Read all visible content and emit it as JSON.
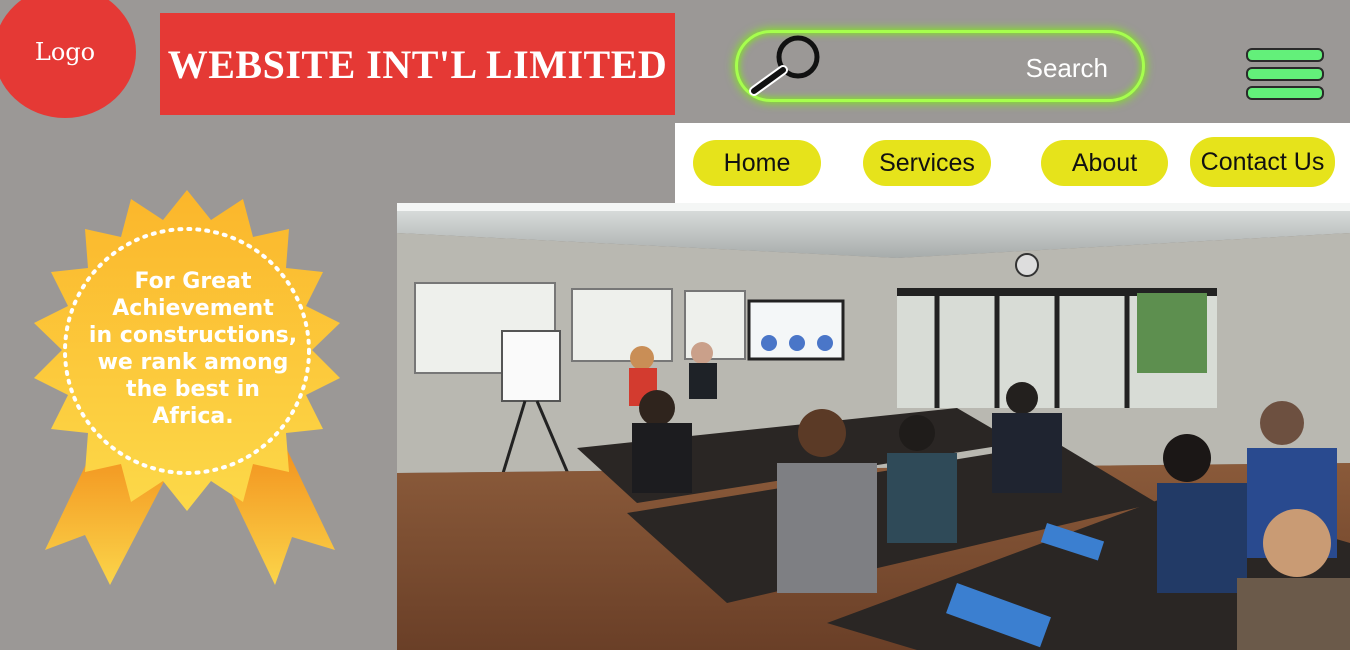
{
  "logo": {
    "label": "Logo"
  },
  "header": {
    "title": "WEBSITE INT'L LIMITED"
  },
  "search": {
    "label": "Search"
  },
  "nav": {
    "items": [
      {
        "label": "Home"
      },
      {
        "label": "Services"
      },
      {
        "label": "About"
      },
      {
        "label": "Contact Us"
      }
    ]
  },
  "badge": {
    "lines": [
      "For Great",
      "Achievement",
      "in constructions,",
      "we rank among",
      "the best in",
      "Africa."
    ]
  },
  "colors": {
    "brand_red": "#e53935",
    "nav_yellow": "#e6e31b",
    "search_glow": "#7cfc00",
    "menu_green": "#63f07a",
    "background": "#9b9896"
  },
  "icons": [
    "magnifier-icon",
    "hamburger-menu-icon",
    "award-ribbon-icon"
  ]
}
